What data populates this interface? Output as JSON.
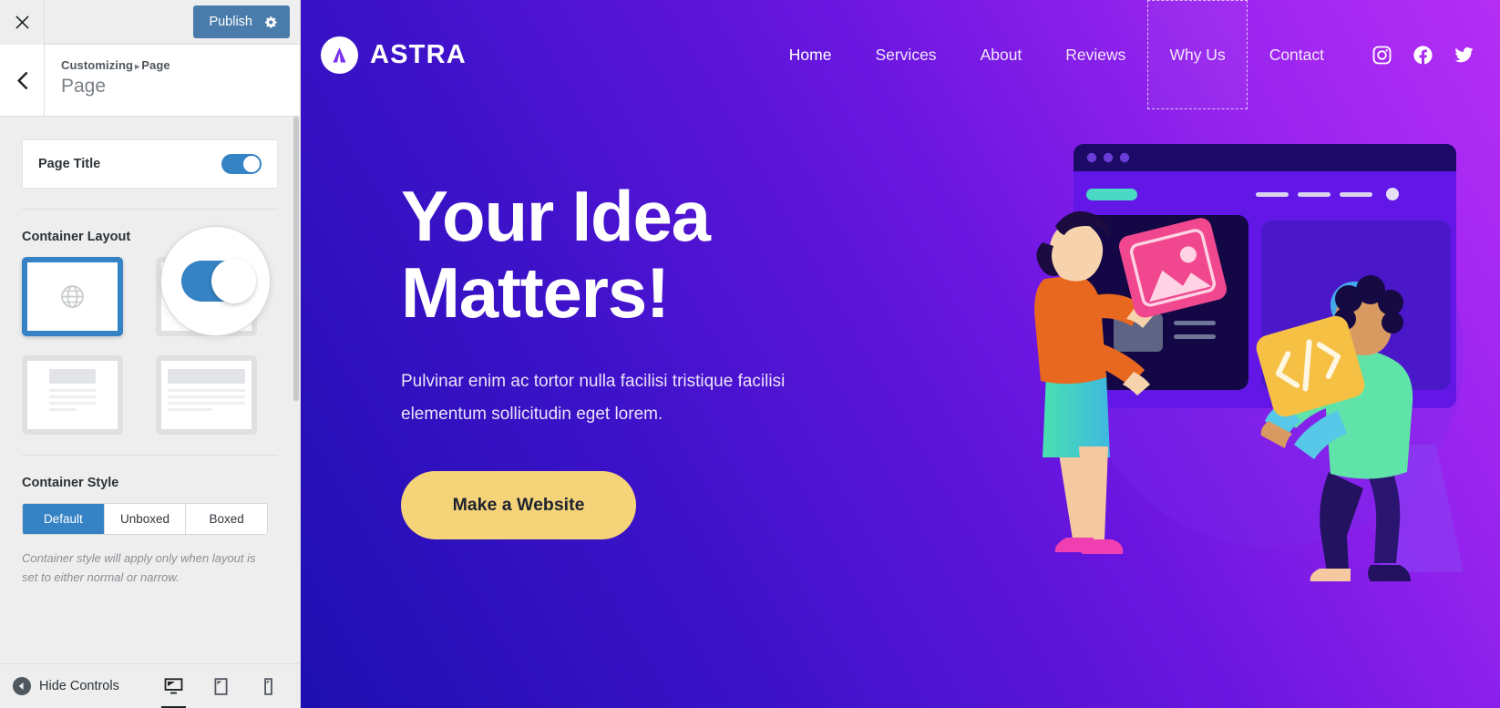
{
  "customizer": {
    "close_icon": "close-icon",
    "publish": {
      "label": "Publish",
      "icon": "gear-icon",
      "color": "#4a7cab"
    },
    "back_icon": "chevron-left-icon",
    "breadcrumb": {
      "root": "Customizing",
      "separator": "▸",
      "current": "Page"
    },
    "panel_title": "Page",
    "page_title_control": {
      "label": "Page Title",
      "state": "on",
      "accent": "#3582c4"
    },
    "container_layout": {
      "title": "Container Layout",
      "options": [
        {
          "name": "full-width-layout",
          "icon": "globe-icon",
          "selected": true
        },
        {
          "name": "normal-layout",
          "selected": false
        },
        {
          "name": "narrow-layout",
          "selected": false
        },
        {
          "name": "full-content-layout",
          "selected": false
        }
      ]
    },
    "container_style": {
      "title": "Container Style",
      "options": [
        "Default",
        "Unboxed",
        "Boxed"
      ],
      "selected": "Default",
      "helper": "Container style will apply only when layout is set to either normal or narrow."
    },
    "footer": {
      "hide_controls": "Hide Controls",
      "devices": [
        {
          "name": "desktop",
          "active": true
        },
        {
          "name": "tablet",
          "active": false
        },
        {
          "name": "mobile",
          "active": false
        }
      ]
    }
  },
  "preview": {
    "brand": {
      "name": "ASTRA",
      "mark": "astra-logo-icon"
    },
    "nav_items": [
      {
        "label": "Home",
        "active": true,
        "outlined": false
      },
      {
        "label": "Services",
        "active": false,
        "outlined": false
      },
      {
        "label": "About",
        "active": false,
        "outlined": false
      },
      {
        "label": "Reviews",
        "active": false,
        "outlined": false
      },
      {
        "label": "Why Us",
        "active": false,
        "outlined": true
      },
      {
        "label": "Contact",
        "active": false,
        "outlined": false
      }
    ],
    "socials": [
      "instagram-icon",
      "facebook-icon",
      "twitter-icon"
    ],
    "hero": {
      "heading": "Your Idea\nMatters!",
      "subtext": "Pulvinar enim ac tortor nulla facilisi tristique facilisi elementum sollicitudin eget lorem.",
      "cta_label": "Make a Website",
      "cta_color": "#f5d378"
    },
    "gradient": {
      "from": "#1e0fb0",
      "to": "#b52ef5"
    }
  }
}
